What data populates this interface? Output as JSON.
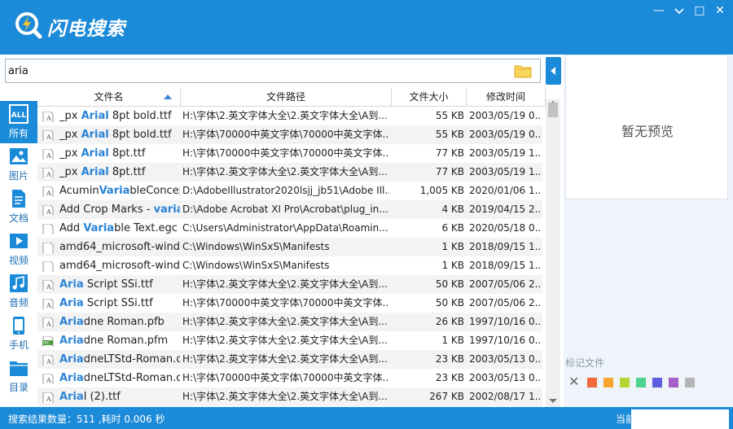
{
  "app": {
    "title": "闪电搜索"
  },
  "window": {
    "minimize": "—",
    "restore": "□",
    "close": "✕"
  },
  "search": {
    "value": "aria"
  },
  "sidebar": {
    "items": [
      {
        "label": "所有",
        "icon": "all-icon",
        "active": true
      },
      {
        "label": "图片",
        "icon": "image-icon"
      },
      {
        "label": "文档",
        "icon": "document-icon"
      },
      {
        "label": "视频",
        "icon": "video-icon"
      },
      {
        "label": "音频",
        "icon": "audio-icon"
      },
      {
        "label": "手机",
        "icon": "phone-icon"
      },
      {
        "label": "目录",
        "icon": "folder-icon"
      }
    ]
  },
  "table": {
    "headers": {
      "name": "文件名",
      "path": "文件路径",
      "size": "文件大小",
      "date": "修改时间"
    },
    "rows": [
      {
        "pre": "_px ",
        "hl": "Arial",
        "post": " 8pt bold.ttf",
        "path": "H:\\字体\\2.英文字体大全\\2.英文字体大全\\A到...",
        "size": "55 KB",
        "date": "2003/05/19 0...",
        "icon": "font-file-icon"
      },
      {
        "pre": "_px ",
        "hl": "Arial",
        "post": " 8pt bold.ttf",
        "path": "H:\\字体\\70000中英文字体\\70000中英文字体...",
        "size": "55 KB",
        "date": "2003/05/19 0...",
        "icon": "font-file-icon"
      },
      {
        "pre": "_px ",
        "hl": "Arial",
        "post": " 8pt.ttf",
        "path": "H:\\字体\\70000中英文字体\\70000中英文字体...",
        "size": "77 KB",
        "date": "2003/05/19 1...",
        "icon": "font-file-icon"
      },
      {
        "pre": "_px ",
        "hl": "Arial",
        "post": " 8pt.ttf",
        "path": "H:\\字体\\2.英文字体大全\\2.英文字体大全\\A到...",
        "size": "77 KB",
        "date": "2003/05/19 1...",
        "icon": "font-file-icon"
      },
      {
        "pre": "Acumin",
        "hl": "Varia",
        "post": "bleConcep...",
        "path": "D:\\AdobeIllustrator2020lsjj_jb51\\Adobe Ill...",
        "size": "1,005 KB",
        "date": "2020/01/06 1...",
        "icon": "font-file-icon"
      },
      {
        "pre": "Add Crop Marks - ",
        "hl": "varia",
        "post": "b",
        "path": "D:\\Adobe Acrobat XI Pro\\Acrobat\\plug_in...",
        "size": "4 KB",
        "date": "2019/04/15 2...",
        "icon": "font-file-icon"
      },
      {
        "pre": "Add ",
        "hl": "Varia",
        "post": "ble Text.egc",
        "path": "C:\\Users\\Administrator\\AppData\\Roamin...",
        "size": "6 KB",
        "date": "2020/05/18 0...",
        "icon": "blank-file-icon"
      },
      {
        "pre": "amd64_microsoft-wind...",
        "hl": "",
        "post": "",
        "path": "C:\\Windows\\WinSxS\\Manifests",
        "size": "1 KB",
        "date": "2018/09/15 1...",
        "icon": "blank-file-icon"
      },
      {
        "pre": "amd64_microsoft-wind...",
        "hl": "",
        "post": "",
        "path": "C:\\Windows\\WinSxS\\Manifests",
        "size": "1 KB",
        "date": "2018/09/15 1...",
        "icon": "blank-file-icon"
      },
      {
        "pre": "",
        "hl": "Aria",
        "post": " Script SSi.ttf",
        "path": "H:\\字体\\2.英文字体大全\\2.英文字体大全\\A到...",
        "size": "50 KB",
        "date": "2007/05/06 2...",
        "icon": "font-file-icon"
      },
      {
        "pre": "",
        "hl": "Aria",
        "post": " Script SSi.ttf",
        "path": "H:\\字体\\70000中英文字体\\70000中英文字体...",
        "size": "50 KB",
        "date": "2007/05/06 2...",
        "icon": "font-file-icon"
      },
      {
        "pre": "",
        "hl": "Aria",
        "post": "dne Roman.pfb",
        "path": "H:\\字体\\2.英文字体大全\\2.英文字体大全\\A到...",
        "size": "26 KB",
        "date": "1997/10/16 0...",
        "icon": "font-file-icon"
      },
      {
        "pre": "",
        "hl": "Aria",
        "post": "dne Roman.pfm",
        "path": "H:\\字体\\2.英文字体大全\\2.英文字体大全\\A到...",
        "size": "1 KB",
        "date": "1997/10/16 0...",
        "icon": "pic-file-icon"
      },
      {
        "pre": "",
        "hl": "Aria",
        "post": "dneLTStd-Roman.otf",
        "path": "H:\\字体\\2.英文字体大全\\2.英文字体大全\\A到...",
        "size": "23 KB",
        "date": "2003/05/13 0...",
        "icon": "font-file-icon"
      },
      {
        "pre": "",
        "hl": "Aria",
        "post": "dneLTStd-Roman.otf",
        "path": "H:\\字体\\70000中英文字体\\70000中英文字体...",
        "size": "23 KB",
        "date": "2003/05/13 0...",
        "icon": "font-file-icon"
      },
      {
        "pre": "",
        "hl": "Aria",
        "post": "l (2).ttf",
        "path": "H:\\字体\\2.英文字体大全\\2.英文字体大全\\A到...",
        "size": "267 KB",
        "date": "2002/08/17 1...",
        "icon": "font-file-icon"
      }
    ]
  },
  "preview": {
    "empty_text": "暂无预览"
  },
  "marks": {
    "label": "标记文件",
    "clear": "✕",
    "colors": [
      "#f06b3c",
      "#f7a531",
      "#b6d434",
      "#4dd38f",
      "#5b5fe0",
      "#a65ec8",
      "#b5b5b5"
    ]
  },
  "status": {
    "result_text": "搜索结果数量：511 ,耗时 0.006 秒",
    "right_text": "当前"
  },
  "colors": {
    "accent": "#1b8ad8",
    "highlight": "#2a83d6"
  }
}
